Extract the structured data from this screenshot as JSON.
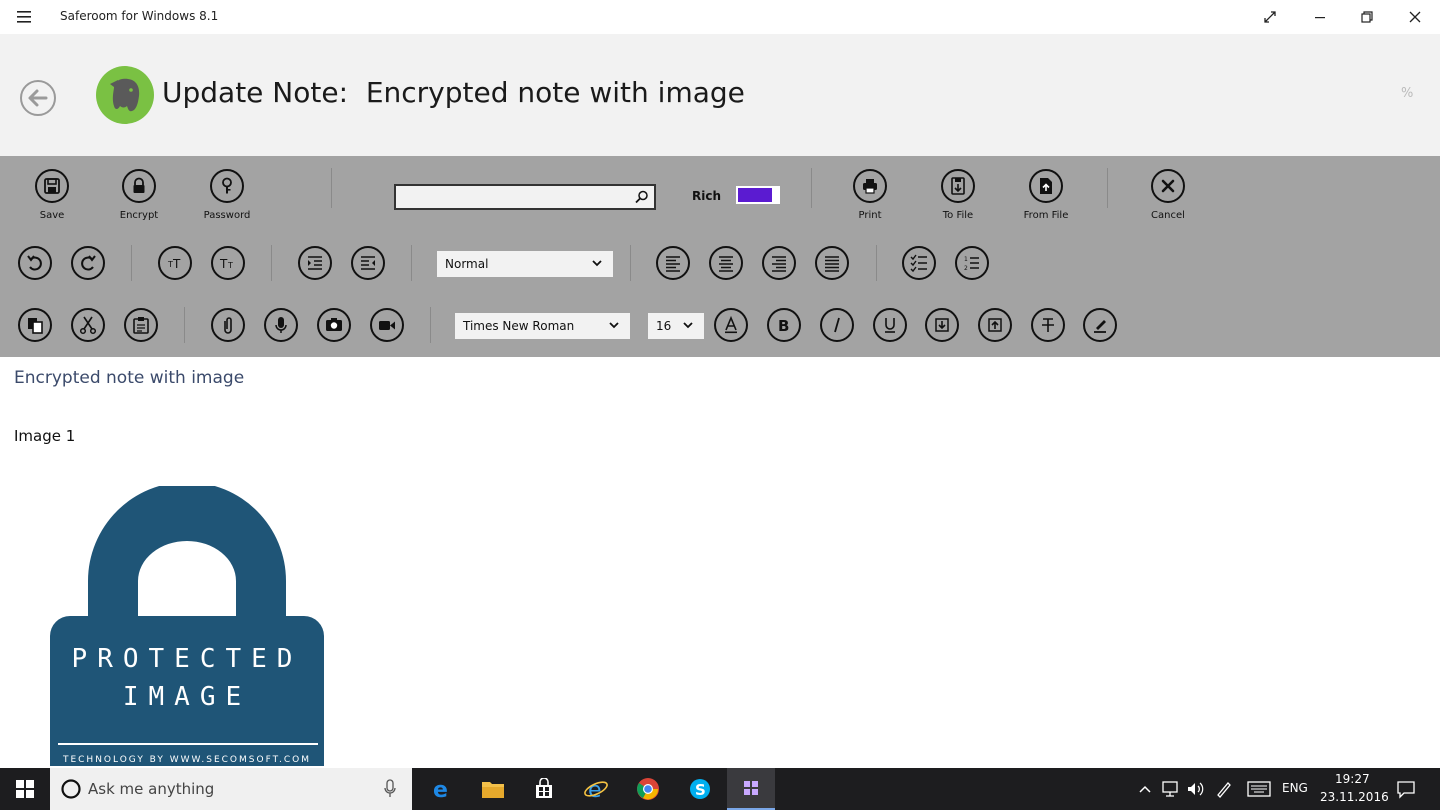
{
  "window": {
    "title": "Saferoom for Windows 8.1"
  },
  "header": {
    "title": "Update Note:  Encrypted note with image",
    "percent": "%"
  },
  "toolbar": {
    "row1": {
      "save": "Save",
      "encrypt": "Encrypt",
      "password": "Password",
      "search_placeholder": "",
      "rich_label": "Rich",
      "rich_enabled": true,
      "rich_color": "#5b1bd1",
      "print": "Print",
      "to_file": "To File",
      "from_file": "From File",
      "cancel": "Cancel"
    },
    "row2": {
      "paragraph_style": "Normal"
    },
    "row3": {
      "font_family": "Times New Roman",
      "font_size": "16"
    }
  },
  "content": {
    "note_title": "Encrypted note with image",
    "image_label": "Image 1",
    "image": {
      "line1": "PROTECTED",
      "line2": "IMAGE",
      "footer": "TECHNOLOGY BY WWW.SECOMSOFT.COM",
      "color": "#1f5577"
    }
  },
  "taskbar": {
    "search_placeholder": "Ask me anything",
    "language": "ENG",
    "time": "19:27",
    "date": "23.11.2016"
  },
  "colors": {
    "toolbar_bg": "#a3a3a3",
    "header_bg": "#f2f2f2",
    "logo_green": "#7ac143"
  }
}
